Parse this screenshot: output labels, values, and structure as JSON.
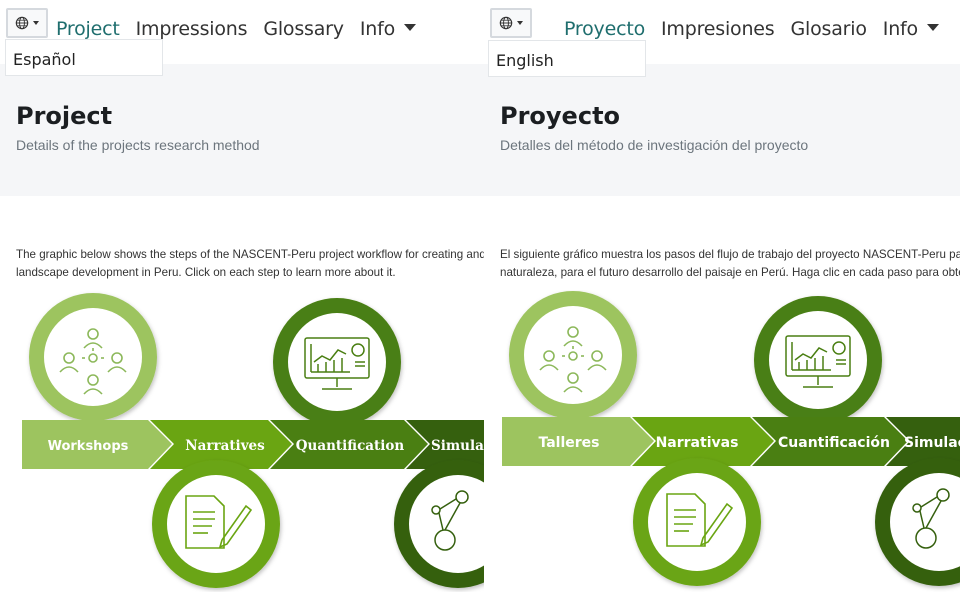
{
  "left": {
    "nav": {
      "links": [
        "Project",
        "Impressions",
        "Glossary",
        "Info"
      ],
      "lang_option": "Español"
    },
    "header": {
      "title": "Project",
      "subtitle": "Details of the projects research method"
    },
    "intro": {
      "line1": "The graphic below shows the steps of the NASCENT-Peru project workflow for creating and",
      "line2": "landscape development in Peru. Click on each step to learn more about it."
    },
    "steps": [
      "Workshops",
      "Narratives",
      "Quantification",
      "Simulat"
    ]
  },
  "right": {
    "nav": {
      "links": [
        "Proyecto",
        "Impresiones",
        "Glosario",
        "Info"
      ],
      "lang_option": "English"
    },
    "header": {
      "title": "Proyecto",
      "subtitle": "Detalles del método de investigación del proyecto"
    },
    "intro": {
      "line1": "El siguiente gráfico muestra los pasos del flujo de trabajo del proyecto NASCENT-Peru par",
      "line2": "naturaleza, para el futuro desarrollo del paisaje en Perú. Haga clic en cada paso para obte"
    },
    "steps": [
      "Talleres",
      "Narrativas",
      "Cuantificación",
      "Simulac"
    ]
  },
  "colors": {
    "step1": "#9dc45f",
    "step2": "#6aa512",
    "step3": "#4a7f12",
    "step4": "#35600e",
    "nav_active": "#1f6e6e"
  },
  "icons": [
    "globe-icon",
    "people-idea-icon",
    "chart-monitor-icon",
    "document-pen-icon",
    "network-icon"
  ]
}
